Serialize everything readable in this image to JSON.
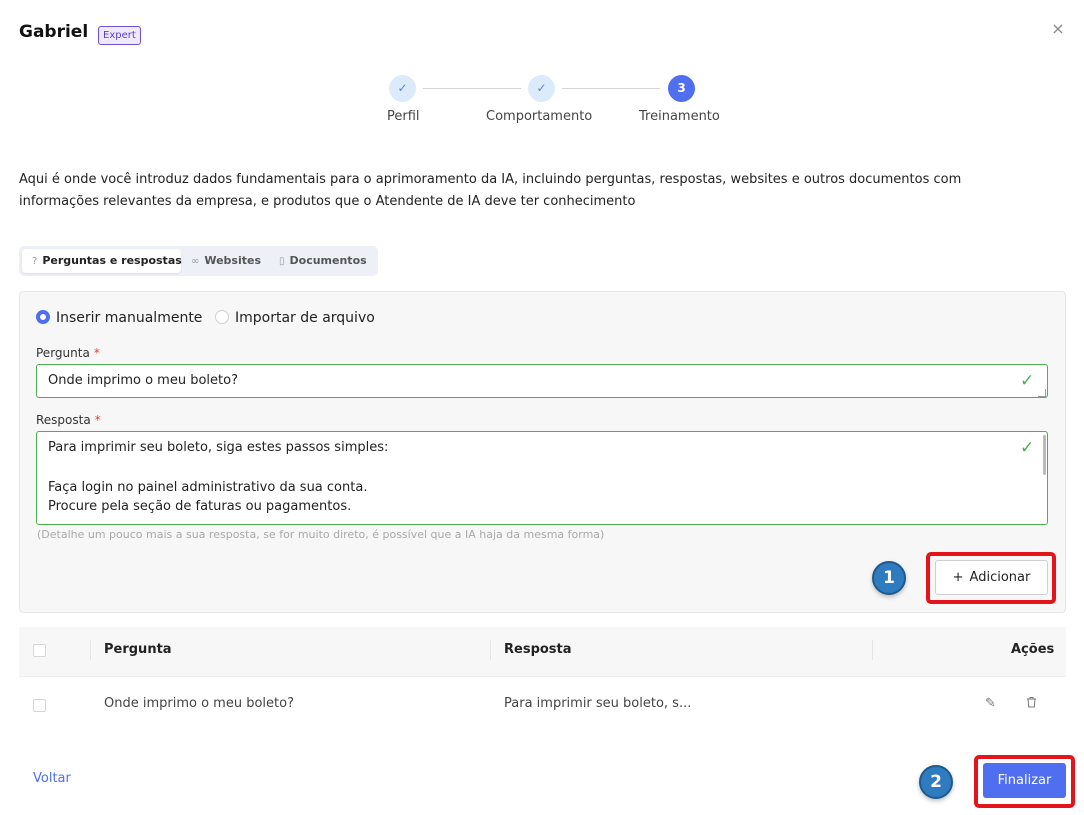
{
  "header": {
    "agent_name": "Gabriel",
    "badge": "Expert",
    "close_symbol": "×"
  },
  "stepper": {
    "steps": [
      {
        "label": "Perfil",
        "state": "done",
        "marker": "✓"
      },
      {
        "label": "Comportamento",
        "state": "done",
        "marker": "✓"
      },
      {
        "label": "Treinamento",
        "state": "active",
        "marker": "3"
      }
    ]
  },
  "intro_text": "Aqui é onde você introduz dados fundamentais para o aprimoramento da IA, incluindo perguntas, respostas, websites e outros documentos com informações relevantes da empresa, e produtos que o Atendente de IA deve ter conhecimento",
  "tabs": [
    {
      "label": "Perguntas e respostas",
      "icon": "question-circle-icon",
      "active": true
    },
    {
      "label": "Websites",
      "icon": "link-icon",
      "active": false
    },
    {
      "label": "Documentos",
      "icon": "document-icon",
      "active": false
    }
  ],
  "form": {
    "mode_options": [
      {
        "label": "Inserir manualmente",
        "selected": true
      },
      {
        "label": "Importar de arquivo",
        "selected": false
      }
    ],
    "question_label": "Pergunta",
    "question_value": "Onde imprimo o meu boleto?",
    "answer_label": "Resposta",
    "answer_lines": [
      "Para imprimir seu boleto, siga estes passos simples:",
      "",
      "Faça login no painel administrativo da sua conta.",
      "Procure pela seção de faturas ou pagamentos."
    ],
    "required_marker": "*",
    "hint": "(Detalhe um pouco mais a sua resposta, se for muito direto, é possível que a IA haja da mesma forma)",
    "add_button_label": "Adicionar",
    "add_button_icon": "plus-icon"
  },
  "annotations": {
    "marker_1": "1",
    "marker_2": "2"
  },
  "table": {
    "columns": [
      "Pergunta",
      "Resposta",
      "Ações"
    ],
    "rows": [
      {
        "question": "Onde imprimo o meu boleto?",
        "answer": "Para imprimir seu boleto, s...",
        "actions": [
          "edit-icon",
          "trash-icon"
        ]
      }
    ]
  },
  "footer": {
    "back_label": "Voltar",
    "finish_label": "Finalizar"
  },
  "colors": {
    "primary": "#4f6ff0",
    "valid": "#4caf50",
    "annotation_box": "#e3151b",
    "annotation_bubble": "#2f7bbf"
  }
}
